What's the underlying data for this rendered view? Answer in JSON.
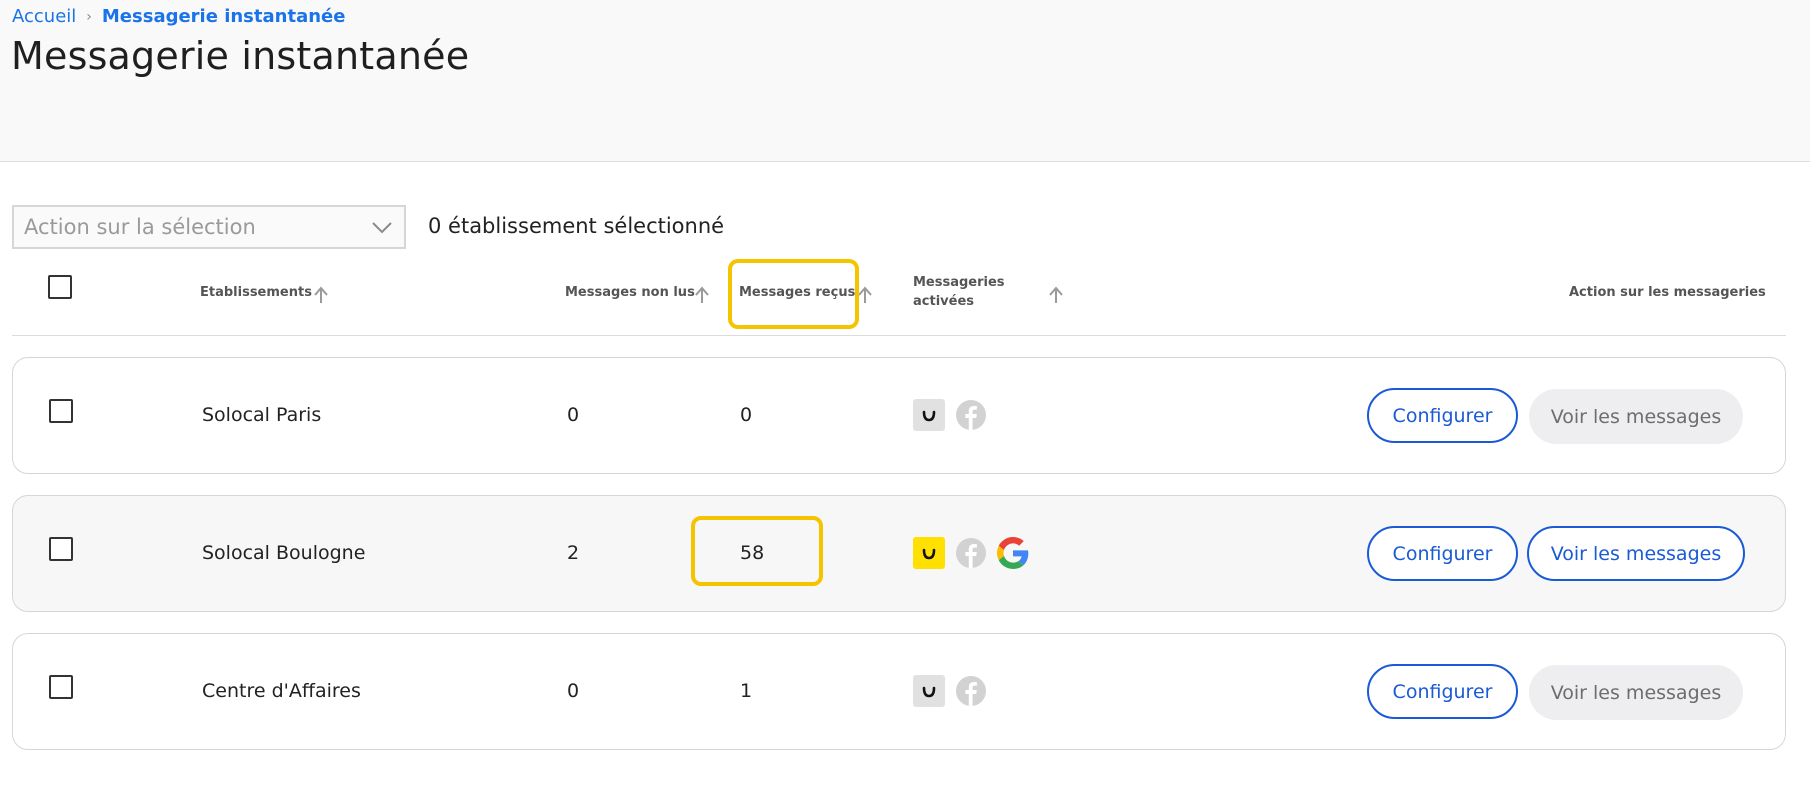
{
  "breadcrumb": {
    "home": "Accueil",
    "separator": "›",
    "current": "Messagerie instantanée"
  },
  "page_title": "Messagerie instantanée",
  "selection": {
    "action_placeholder": "Action sur la sélection",
    "count_text": "0 établissement sélectionné"
  },
  "columns": {
    "establishments": "Etablissements",
    "unread": "Messages non lus",
    "received": "Messages reçus",
    "activated_line1": "Messageries",
    "activated_line2": "activées",
    "actions": "Action sur les messageries"
  },
  "rows": [
    {
      "name": "Solocal Paris",
      "unread": "0",
      "received": "0",
      "channels": [
        "pagesjaunes-icon-inactive",
        "facebook-icon-inactive"
      ],
      "configure_label": "Configurer",
      "view_label": "Voir les messages",
      "view_enabled": false
    },
    {
      "name": "Solocal Boulogne",
      "unread": "2",
      "received": "58",
      "channels": [
        "pagesjaunes-icon-active",
        "facebook-icon-inactive",
        "google-icon-active"
      ],
      "configure_label": "Configurer",
      "view_label": "Voir les messages",
      "view_enabled": true
    },
    {
      "name": "Centre d'Affaires",
      "unread": "0",
      "received": "1",
      "channels": [
        "pagesjaunes-icon-inactive",
        "facebook-icon-inactive"
      ],
      "configure_label": "Configurer",
      "view_label": "Voir les messages",
      "view_enabled": false
    }
  ],
  "colors": {
    "accent_blue": "#1a5ad6",
    "link_blue": "#1a73e8",
    "highlight_yellow": "#f5c400",
    "pagesjaunes_yellow": "#ffe000",
    "disabled_button_bg": "#eeeef0"
  }
}
